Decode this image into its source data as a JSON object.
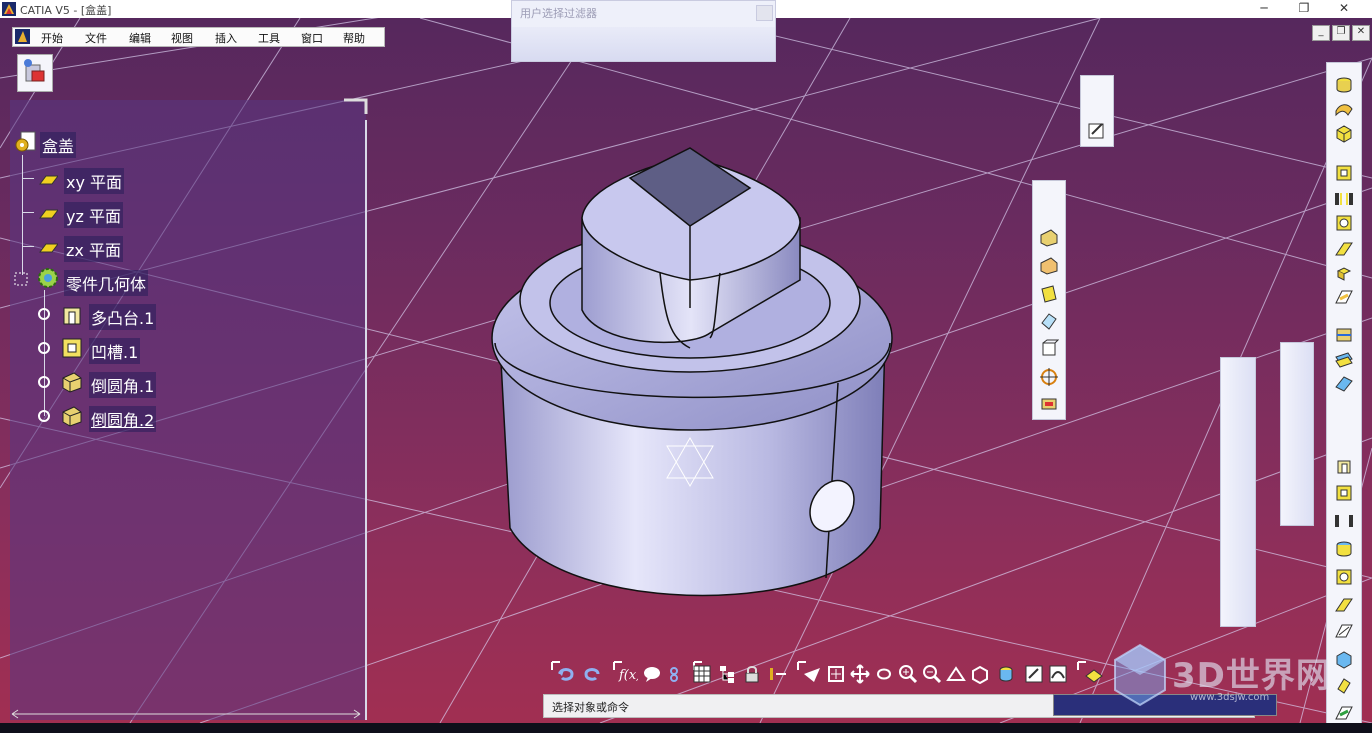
{
  "window": {
    "title": "CATIA V5 - [盒盖]",
    "minimize": "─",
    "maximize": "❐",
    "close": "✕"
  },
  "menu": {
    "items": [
      "开始",
      "文件",
      "编辑",
      "视图",
      "插入",
      "工具",
      "窗口",
      "帮助"
    ]
  },
  "filter_dialog": {
    "title": "用户选择过滤器"
  },
  "tree": {
    "root": "盒盖",
    "planes": [
      "xy 平面",
      "yz 平面",
      "zx 平面"
    ],
    "body": "零件几何体",
    "features": [
      "多凸台.1",
      "凹槽.1",
      "倒圆角.1",
      "倒圆角.2"
    ]
  },
  "status": {
    "prompt": "选择对象或命令",
    "command_value": ""
  },
  "watermark": {
    "brand": "3D世界网",
    "url": "www.3dsjw.com"
  },
  "colors": {
    "viewport_top": "#56285d",
    "viewport_bottom": "#a12f52",
    "part": "#c9c9ec",
    "grid": "#d8d0f0"
  },
  "icons": {
    "tree_root": "part-document-icon",
    "plane": "plane-icon",
    "body": "part-body-gear-icon",
    "multi_pad": "multi-pad-icon",
    "pocket": "pocket-icon",
    "fillet": "edge-fillet-icon"
  }
}
